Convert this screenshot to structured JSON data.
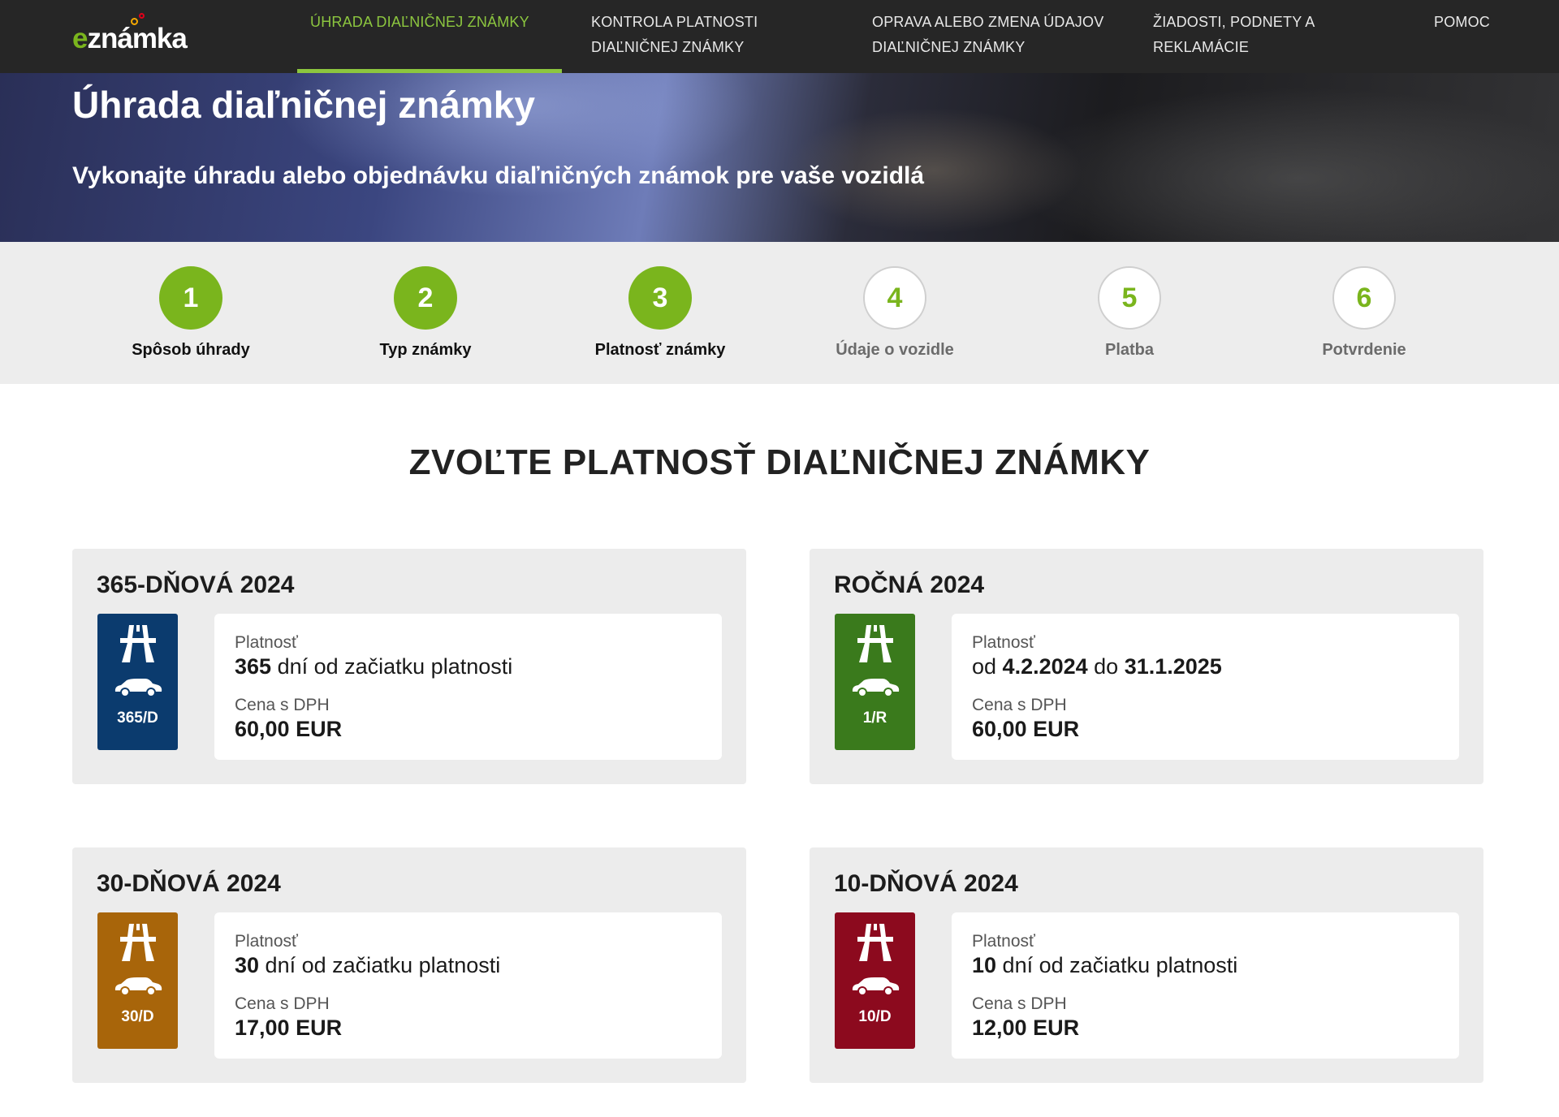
{
  "logo": {
    "e": "e",
    "rest": "známka"
  },
  "nav": [
    {
      "line1": "ÚHRADA DIAĽNIČNEJ ZNÁMKY",
      "line2": ""
    },
    {
      "line1": "KONTROLA PLATNOSTI",
      "line2": "DIAĽNIČNEJ ZNÁMKY"
    },
    {
      "line1": "OPRAVA ALEBO ZMENA ÚDAJOV",
      "line2": "DIAĽNIČNEJ ZNÁMKY"
    },
    {
      "line1": "ŽIADOSTI, PODNETY A",
      "line2": "REKLAMÁCIE"
    },
    {
      "line1": "POMOC",
      "line2": ""
    }
  ],
  "hero": {
    "title": "Úhrada diaľničnej známky",
    "subtitle": "Vykonajte úhradu alebo objednávku diaľničných známok pre vaše vozidlá"
  },
  "steps": [
    {
      "num": "1",
      "label": "Spôsob úhrady",
      "state": "done"
    },
    {
      "num": "2",
      "label": "Typ známky",
      "state": "done"
    },
    {
      "num": "3",
      "label": "Platnosť známky",
      "state": "done"
    },
    {
      "num": "4",
      "label": "Údaje o vozidle",
      "state": "todo"
    },
    {
      "num": "5",
      "label": "Platba",
      "state": "todo"
    },
    {
      "num": "6",
      "label": "Potvrdenie",
      "state": "todo"
    }
  ],
  "section_title": "ZVOĽTE PLATNOSŤ DIAĽNIČNEJ ZNÁMKY",
  "labels": {
    "validity": "Platnosť",
    "price": "Cena s DPH"
  },
  "cards": [
    {
      "title": "365-DŇOVÁ 2024",
      "badge_code": "365/D",
      "badge_color": "#0b3b6e",
      "validity_bold": "365",
      "validity_rest": " dní od začiatku platnosti",
      "price": "60,00 EUR"
    },
    {
      "title": "ROČNÁ 2024",
      "badge_code": "1/R",
      "badge_color": "#3a7a1c",
      "validity_from": "od ",
      "date_from": "4.2.2024",
      "validity_to": " do ",
      "date_to": "31.1.2025",
      "price": "60,00 EUR"
    },
    {
      "title": "30-DŇOVÁ 2024",
      "badge_code": "30/D",
      "badge_color": "#a8650a",
      "validity_bold": "30",
      "validity_rest": " dní od začiatku platnosti",
      "price": "17,00 EUR"
    },
    {
      "title": "10-DŇOVÁ 2024",
      "badge_code": "10/D",
      "badge_color": "#8c0a1e",
      "validity_bold": "10",
      "validity_rest": " dní od začiatku platnosti",
      "price": "12,00 EUR"
    }
  ]
}
